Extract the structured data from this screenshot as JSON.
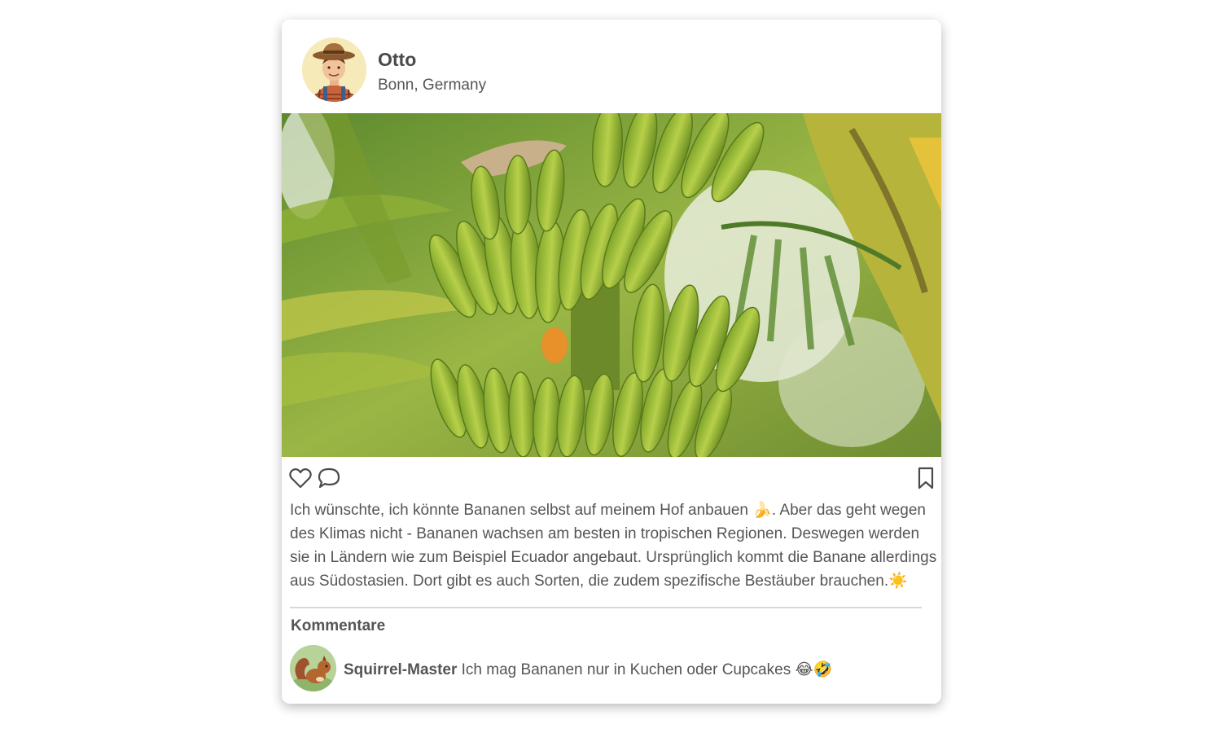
{
  "post": {
    "author": "Otto",
    "location": "Bonn, Germany",
    "caption": "Ich wünschte, ich könnte Bananen selbst auf meinem Hof anbauen 🍌. Aber das geht wegen des Klimas nicht - Bananen wachsen am besten in tropischen Regionen. Deswegen werden sie in Ländern wie zum Beispiel Ecuador angebaut. Ursprünglich kommt die Banane allerdings aus Südostasien. Dort gibt es auch Sorten, die zudem spezifische Bestäuber brauchen.☀️"
  },
  "actions": {
    "like_icon": "heart-icon",
    "comment_icon": "speech-bubble-icon",
    "save_icon": "bookmark-icon"
  },
  "comments": {
    "title": "Kommentare",
    "items": [
      {
        "author": "Squirrel-Master",
        "text": "Ich mag Bananen nur in Kuchen oder Cupcakes 😂🤣"
      }
    ]
  }
}
